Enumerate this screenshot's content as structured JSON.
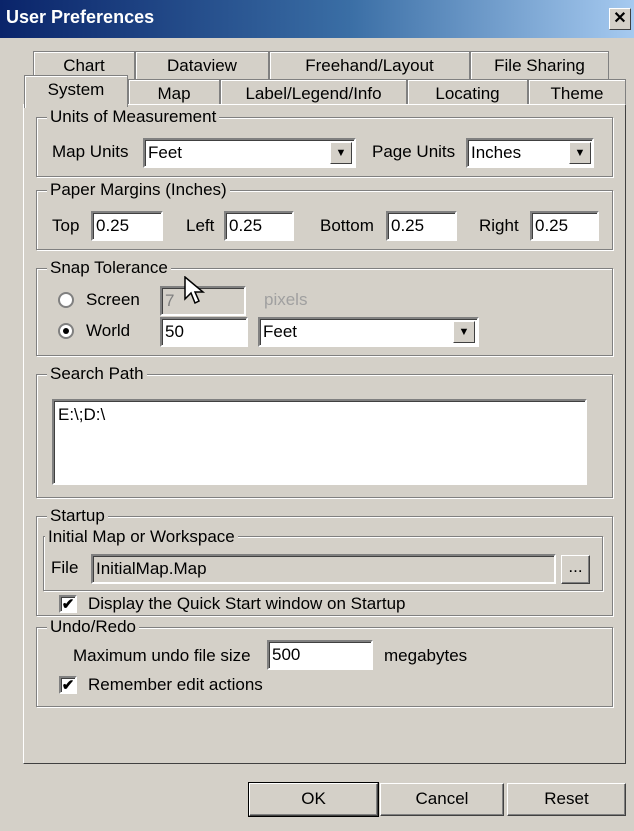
{
  "window": {
    "title": "User Preferences",
    "close_glyph": "✕"
  },
  "tabs_back": [
    "Chart",
    "Dataview",
    "Freehand/Layout",
    "File Sharing"
  ],
  "tabs_front": [
    "System",
    "Map",
    "Label/Legend/Info",
    "Locating",
    "Theme"
  ],
  "active_tab": "System",
  "units": {
    "legend": "Units of Measurement",
    "map_units_label": "Map Units",
    "map_units_value": "Feet",
    "page_units_label": "Page Units",
    "page_units_value": "Inches"
  },
  "margins": {
    "legend": "Paper Margins (Inches)",
    "top_label": "Top",
    "top_value": "0.25",
    "left_label": "Left",
    "left_value": "0.25",
    "bottom_label": "Bottom",
    "bottom_value": "0.25",
    "right_label": "Right",
    "right_value": "0.25"
  },
  "snap": {
    "legend": "Snap Tolerance",
    "screen_label": "Screen",
    "screen_value": "7",
    "pixels_label": "pixels",
    "world_label": "World",
    "world_value": "50",
    "world_units": "Feet",
    "selected": "World"
  },
  "search_path": {
    "legend": "Search Path",
    "value": "E:\\;D:\\"
  },
  "startup": {
    "legend": "Startup",
    "initial_legend": "Initial Map or Workspace",
    "file_label": "File",
    "file_value": "InitialMap.Map",
    "browse_label": "...",
    "quickstart_label": "Display the Quick Start window on Startup",
    "quickstart_checked": true
  },
  "undo": {
    "legend": "Undo/Redo",
    "max_label": "Maximum undo file size",
    "max_value": "500",
    "units_label": "megabytes",
    "remember_label": "Remember edit actions",
    "remember_checked": true
  },
  "buttons": {
    "ok": "OK",
    "cancel": "Cancel",
    "reset": "Reset"
  },
  "check_glyph": "✔",
  "dropdown_glyph": "▼"
}
